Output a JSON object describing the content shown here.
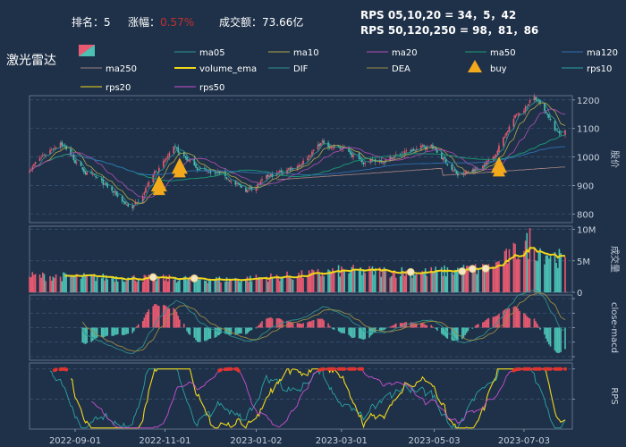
{
  "header": {
    "rank_label": "排名：5",
    "change_prefix": "涨幅：",
    "change_value": "0.57%",
    "amount_label": "成交额：73.66亿",
    "rps_line1": "RPS 05,10,20 = 34，5，42",
    "rps_line2": "RPS 50,120,250 = 98，81，86",
    "stock_name": "激光雷达"
  },
  "legend": [
    {
      "name": "ma05",
      "color": "#2f9c95",
      "kind": "line"
    },
    {
      "name": "ma10",
      "color": "#b3a84b",
      "kind": "line"
    },
    {
      "name": "ma20",
      "color": "#b04fb2",
      "kind": "line"
    },
    {
      "name": "ma50",
      "color": "#1b9e77",
      "kind": "line"
    },
    {
      "name": "ma120",
      "color": "#2f6fb0",
      "kind": "line"
    },
    {
      "name": "ma250",
      "color": "#a08080",
      "kind": "line"
    },
    {
      "name": "volume_ema",
      "color": "#f1d61c",
      "kind": "thick-line"
    },
    {
      "name": "DIF",
      "color": "#2f8f8a",
      "kind": "line"
    },
    {
      "name": "DEA",
      "color": "#9a8b44",
      "kind": "line"
    },
    {
      "name": "buy",
      "color": "#f2a91c",
      "kind": "triangle"
    },
    {
      "name": "rps10",
      "color": "#2aa3a3",
      "kind": "line"
    },
    {
      "name": "rps20",
      "color": "#f1d61c",
      "kind": "line"
    },
    {
      "name": "rps50",
      "color": "#c84fd0",
      "kind": "line"
    }
  ],
  "colors": {
    "background": "#1f3149",
    "up": "#e85a71",
    "down": "#4bc0b3",
    "text": "#ffffff",
    "axis_text": "#c8d0dc",
    "gridline": "#3b5574"
  },
  "x_axis": {
    "tick_labels": [
      "2022-09-01",
      "2022-11-01",
      "2023-01-02",
      "2023-03-01",
      "2023-05-03",
      "2023-07-03"
    ]
  },
  "chart_data": [
    {
      "type": "candlestick",
      "panel": "price",
      "ylabel": "股价",
      "yticks": [
        800,
        900,
        1000,
        1100,
        1200
      ],
      "ylim": [
        770,
        1215
      ],
      "start_date": "2022-08-01",
      "end_date": "2023-07-31",
      "anchors": [
        {
          "date": "2022-08-01",
          "close": 960
        },
        {
          "date": "2022-08-22",
          "close": 1060
        },
        {
          "date": "2022-09-05",
          "close": 960
        },
        {
          "date": "2022-09-20",
          "close": 900
        },
        {
          "date": "2022-10-10",
          "close": 820
        },
        {
          "date": "2022-10-25",
          "close": 945
        },
        {
          "date": "2022-11-07",
          "close": 1020
        },
        {
          "date": "2022-11-25",
          "close": 960
        },
        {
          "date": "2022-12-10",
          "close": 940
        },
        {
          "date": "2022-12-25",
          "close": 880
        },
        {
          "date": "2023-01-05",
          "close": 910
        },
        {
          "date": "2023-02-01",
          "close": 980
        },
        {
          "date": "2023-02-15",
          "close": 1050
        },
        {
          "date": "2023-03-01",
          "close": 1030
        },
        {
          "date": "2023-03-20",
          "close": 980
        },
        {
          "date": "2023-04-10",
          "close": 1010
        },
        {
          "date": "2023-05-01",
          "close": 1040
        },
        {
          "date": "2023-05-20",
          "close": 930
        },
        {
          "date": "2023-06-01",
          "close": 960
        },
        {
          "date": "2023-06-12",
          "close": 1000
        },
        {
          "date": "2023-06-25",
          "close": 1130
        },
        {
          "date": "2023-07-10",
          "close": 1210
        },
        {
          "date": "2023-07-25",
          "close": 1080
        },
        {
          "date": "2023-07-31",
          "close": 1090
        }
      ],
      "buy_signals": [
        "2022-10-28",
        "2022-11-11",
        "2023-06-16"
      ]
    },
    {
      "type": "bar",
      "panel": "volume",
      "ylabel": "成交量",
      "yticks": [
        0,
        5,
        10
      ],
      "ytick_labels": [
        "0",
        "5M",
        "10M"
      ],
      "ylim": [
        0,
        10.5
      ],
      "level_anchors": [
        {
          "date": "2022-08-01",
          "value": 2.6
        },
        {
          "date": "2022-10-01",
          "value": 2.3
        },
        {
          "date": "2022-12-15",
          "value": 2.0
        },
        {
          "date": "2023-02-01",
          "value": 2.7
        },
        {
          "date": "2023-03-01",
          "value": 3.4
        },
        {
          "date": "2023-05-01",
          "value": 3.2
        },
        {
          "date": "2023-06-10",
          "value": 3.8
        },
        {
          "date": "2023-07-05",
          "value": 7.5
        },
        {
          "date": "2023-07-31",
          "value": 5.0
        }
      ],
      "spike": {
        "date": "2023-07-07",
        "value": 10.2
      }
    },
    {
      "type": "line",
      "panel": "macd",
      "ylabel": "close-macd",
      "yticks": [
        -40,
        -20,
        0,
        20,
        40
      ],
      "ylim": [
        -45,
        45
      ]
    },
    {
      "type": "line",
      "panel": "rps",
      "ylabel": "RPS",
      "yticks": [
        50,
        100
      ],
      "ylim": [
        0,
        110
      ]
    }
  ]
}
